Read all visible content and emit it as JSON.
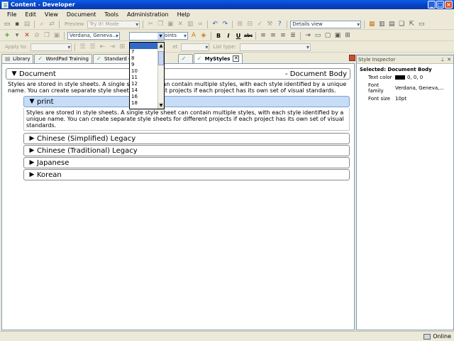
{
  "window": {
    "title": "Content - Developer"
  },
  "menu": [
    "File",
    "Edit",
    "View",
    "Document",
    "Tools",
    "Administration",
    "Help"
  ],
  "toolbar1": {
    "preview_label": "Preview",
    "mode_value": "Try It! Mode",
    "view_value": "Details view"
  },
  "toolbar2": {
    "font_value": "Verdana, Geneva...",
    "size_value": "",
    "units_value": "Points",
    "bold": "B",
    "italic": "I",
    "underline": "U",
    "strike": "abc"
  },
  "toolbar3": {
    "apply_to_label": "Apply to:",
    "list_type_label": "List type:",
    "set_label": "et"
  },
  "font_size_options": [
    "",
    "7",
    "8",
    "9",
    "10",
    "11",
    "12",
    "14",
    "16",
    "18"
  ],
  "tabs": [
    {
      "label": "Library",
      "active": false
    },
    {
      "label": "WordPad Training",
      "active": false
    },
    {
      "label": "Standard (R",
      "active": false
    },
    {
      "label": "MyStyles",
      "active": true
    }
  ],
  "tab_close": "✕",
  "document": {
    "heading": "Document",
    "heading_right": "- Document Body",
    "body_text": "Styles are stored in style sheets. A single style sheet can contain multiple styles, with each style identified by a unique name. You can create separate style sheets for different projects if each project has its own set of visual standards."
  },
  "print_section": {
    "heading": "print",
    "body_text": "Styles are stored in style sheets. A single style sheet can contain multiple styles, with each style identified by a unique name. You can create separate style sheets for different projects if each project has its own set of visual standards."
  },
  "legacy_sections": [
    "Chinese (Simplified) Legacy",
    "Chinese (Traditional) Legacy",
    "Japanese",
    "Korean"
  ],
  "inspector": {
    "title": "Style Inspector",
    "selected": "Selected: Document Body",
    "rows": [
      {
        "key": "Text color",
        "value": "0, 0, 0"
      },
      {
        "key": "Font family",
        "value": "Verdana, Geneva,..."
      },
      {
        "key": "Font size",
        "value": "10pt"
      }
    ]
  },
  "status": {
    "online": "Online"
  },
  "colors": {
    "titlebar": "#0a5ee8",
    "selection": "#316ac5",
    "print_row": "#c7dcf6"
  }
}
